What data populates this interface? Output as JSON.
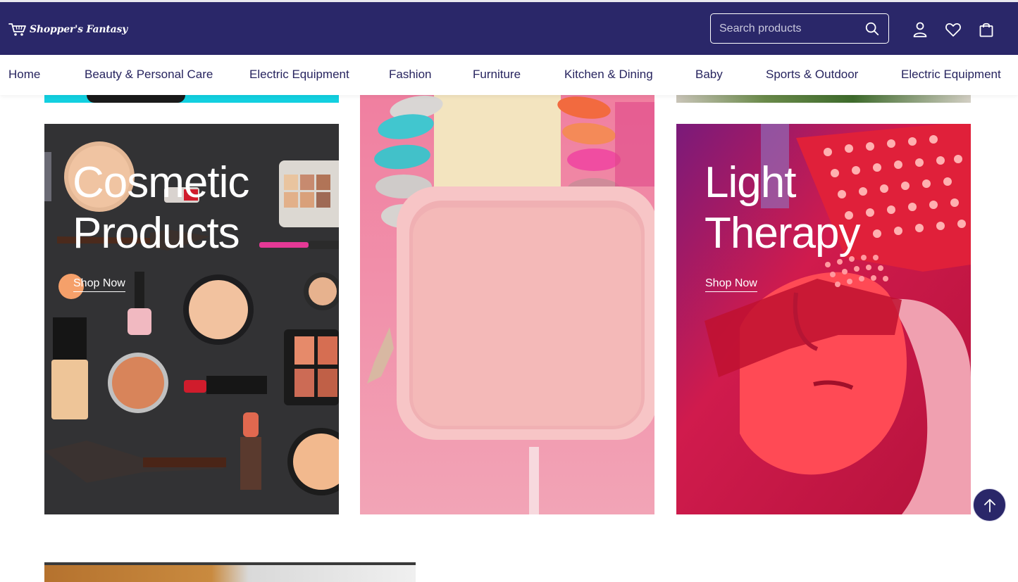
{
  "brand": {
    "name": "Shopper's Fantasy"
  },
  "header": {
    "search_placeholder": "Search products",
    "icons": [
      "account-icon",
      "wishlist-heart-icon",
      "cart-bag-icon",
      "search-icon"
    ]
  },
  "nav": {
    "items": [
      {
        "label": "Home"
      },
      {
        "label": "Beauty & Personal Care"
      },
      {
        "label": "Electric Equipment"
      },
      {
        "label": "Fashion"
      },
      {
        "label": "Furniture"
      },
      {
        "label": "Kitchen & Dining"
      },
      {
        "label": "Baby"
      },
      {
        "label": "Sports & Outdoor"
      },
      {
        "label": "Electric Equipment"
      }
    ]
  },
  "cards": [
    {
      "title_line1": "Cosmetic",
      "title_line2": "Products",
      "cta": "Shop Now"
    },
    {
      "title_line1": "",
      "title_line2": "",
      "cta": ""
    },
    {
      "title_line1": "Light",
      "title_line2": "Therapy",
      "cta": "Shop Now"
    }
  ],
  "colors": {
    "brand": "#2a2769",
    "nav_text": "#27245f"
  }
}
